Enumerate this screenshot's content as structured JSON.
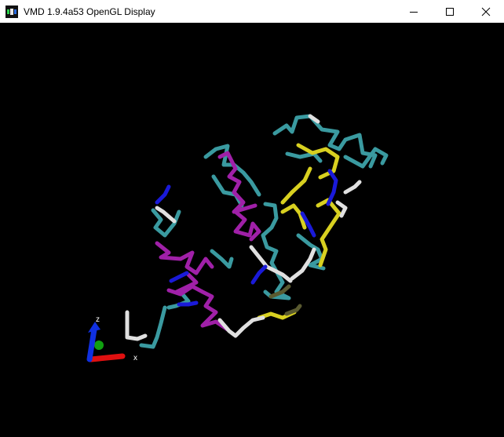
{
  "window": {
    "title": "VMD 1.9.4a53 OpenGL Display"
  },
  "axes": {
    "z_label": "z",
    "x_label": "x"
  },
  "colors": {
    "background": "#000000",
    "coil": "#3a9aa0",
    "helix": "#a020a8",
    "strand": "#d8d020",
    "turn": "#e0e0e0",
    "bridge": "#1a1ad8",
    "axis_x": "#e01010",
    "axis_y": "#10a010",
    "axis_z": "#1030e0"
  }
}
